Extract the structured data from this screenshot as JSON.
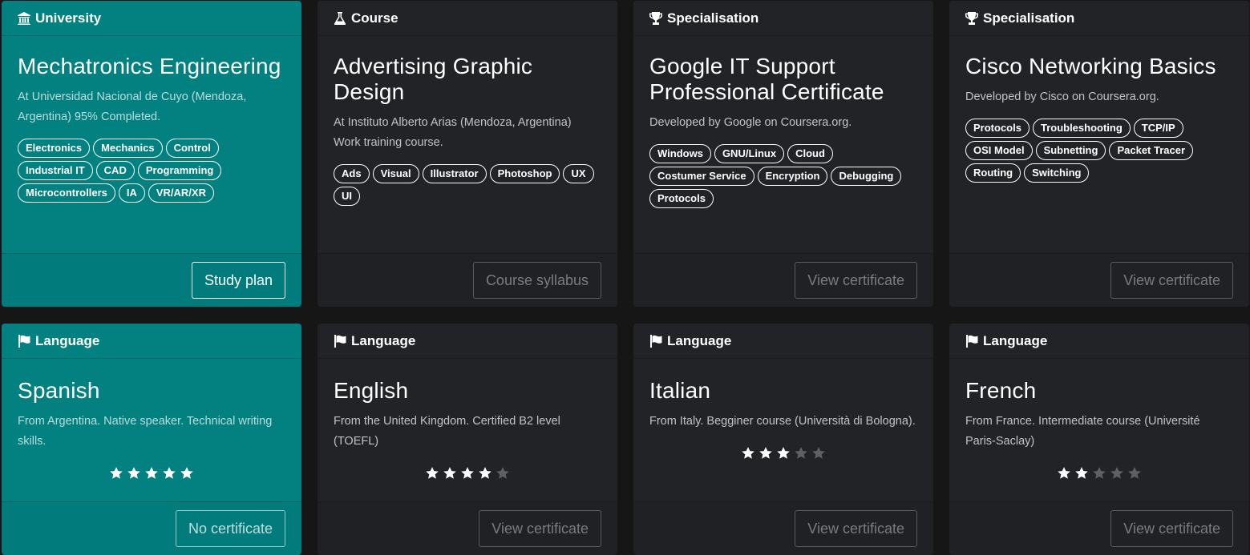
{
  "cards": [
    {
      "category": "University",
      "icon": "university-icon",
      "title": "Mechatronics Engineering",
      "description": "At Universidad Nacional de Cuyo (Mendoza, Argentina) 95% Completed.",
      "tags": [
        "Electronics",
        "Mechanics",
        "Control",
        "Industrial IT",
        "CAD",
        "Programming",
        "Microcontrollers",
        "IA",
        "VR/AR/XR"
      ],
      "button": "Study plan"
    },
    {
      "category": "Course",
      "icon": "flask-icon",
      "title": "Advertising Graphic Design",
      "description": "At Instituto Alberto Arias (Mendoza, Argentina) Work training course.",
      "tags": [
        "Ads",
        "Visual",
        "Illustrator",
        "Photoshop",
        "UX",
        "UI"
      ],
      "button": "Course syllabus"
    },
    {
      "category": "Specialisation",
      "icon": "trophy-icon",
      "title": "Google IT Support Professional Certificate",
      "description": "Developed by Google on Coursera.org.",
      "tags": [
        "Windows",
        "GNU/Linux",
        "Cloud",
        "Costumer Service",
        "Encryption",
        "Debugging",
        "Protocols"
      ],
      "button": "View certificate"
    },
    {
      "category": "Specialisation",
      "icon": "trophy-icon",
      "title": "Cisco Networking Basics",
      "description": "Developed by Cisco on Coursera.org.",
      "tags": [
        "Protocols",
        "Troubleshooting",
        "TCP/IP",
        "OSI Model",
        "Subnetting",
        "Packet Tracer",
        "Routing",
        "Switching"
      ],
      "button": "View certificate"
    },
    {
      "category": "Language",
      "icon": "flag-icon",
      "title": "Spanish",
      "description": "From Argentina. Native speaker. Technical writing skills.",
      "rating": 5,
      "button": "No certificate"
    },
    {
      "category": "Language",
      "icon": "flag-icon",
      "title": "English",
      "description": "From the United Kingdom. Certified B2 level (TOEFL)",
      "rating": 4,
      "button": "View certificate"
    },
    {
      "category": "Language",
      "icon": "flag-icon",
      "title": "Italian",
      "description": "From Italy. Begginer course (Università di Bologna).",
      "rating": 3,
      "button": "View certificate"
    },
    {
      "category": "Language",
      "icon": "flag-icon",
      "title": "French",
      "description": "From France. Intermediate course (Université Paris-Saclay)",
      "rating": 2,
      "button": "View certificate"
    }
  ],
  "rating_max": 5,
  "colors": {
    "teal": "#028180",
    "dark_card": "#222327",
    "background": "#161617"
  }
}
